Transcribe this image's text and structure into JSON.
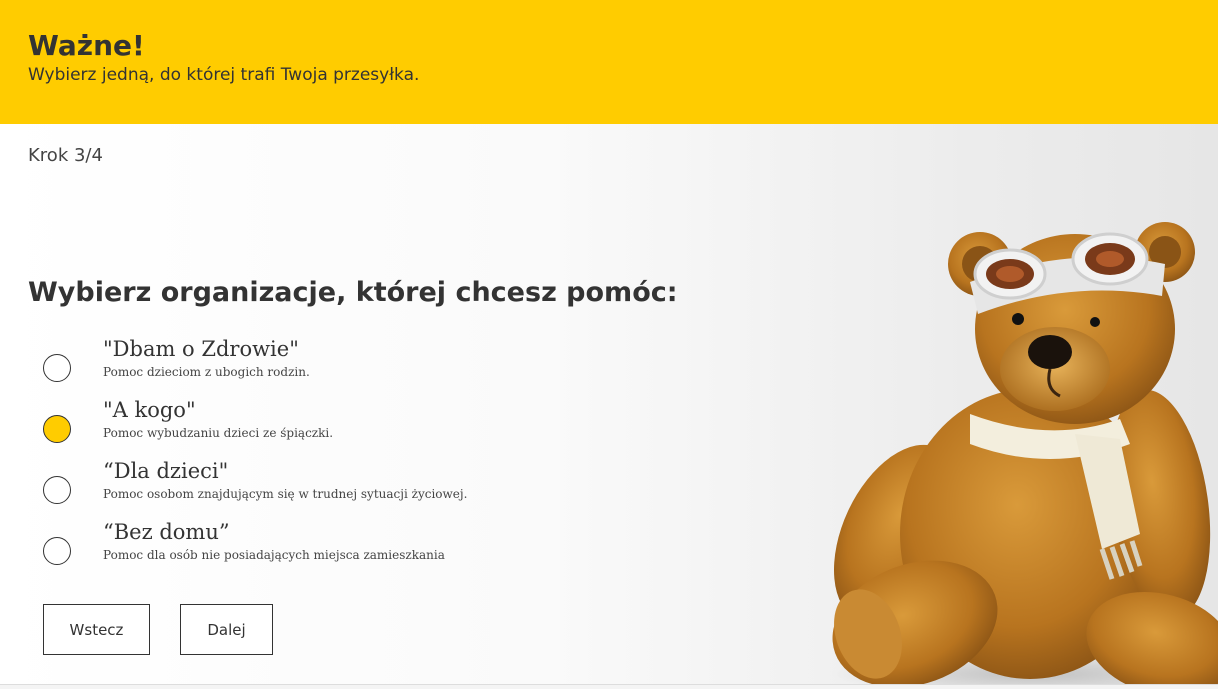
{
  "banner": {
    "title": "Ważne!",
    "subtitle": "Wybierz jedną, do której trafi Twoja przesyłka.",
    "background_color": "#ffcc00"
  },
  "step": "Krok 3/4",
  "question": "Wybierz organizacje, której chcesz pomóc:",
  "options": [
    {
      "title": "\"Dbam o Zdrowie\"",
      "description": "Pomoc dzieciom z ubogich rodzin.",
      "selected": false
    },
    {
      "title": "\"A kogo\"",
      "description": "Pomoc wybudzaniu dzieci ze śpiączki.",
      "selected": true
    },
    {
      "title": "“Dla dzieci\"",
      "description": "Pomoc osobom znajdującym się w trudnej sytuacji życiowej.",
      "selected": false
    },
    {
      "title": "“Bez domu”",
      "description": "Pomoc dla osób nie posiadających miejsca zamieszkania",
      "selected": false
    }
  ],
  "buttons": {
    "back": "Wstecz",
    "next": "Dalej"
  },
  "colors": {
    "accent": "#ffcc00",
    "text": "#333333"
  },
  "icons": {
    "radio_selected": "radio-selected-icon",
    "radio_unselected": "radio-unselected-icon"
  }
}
